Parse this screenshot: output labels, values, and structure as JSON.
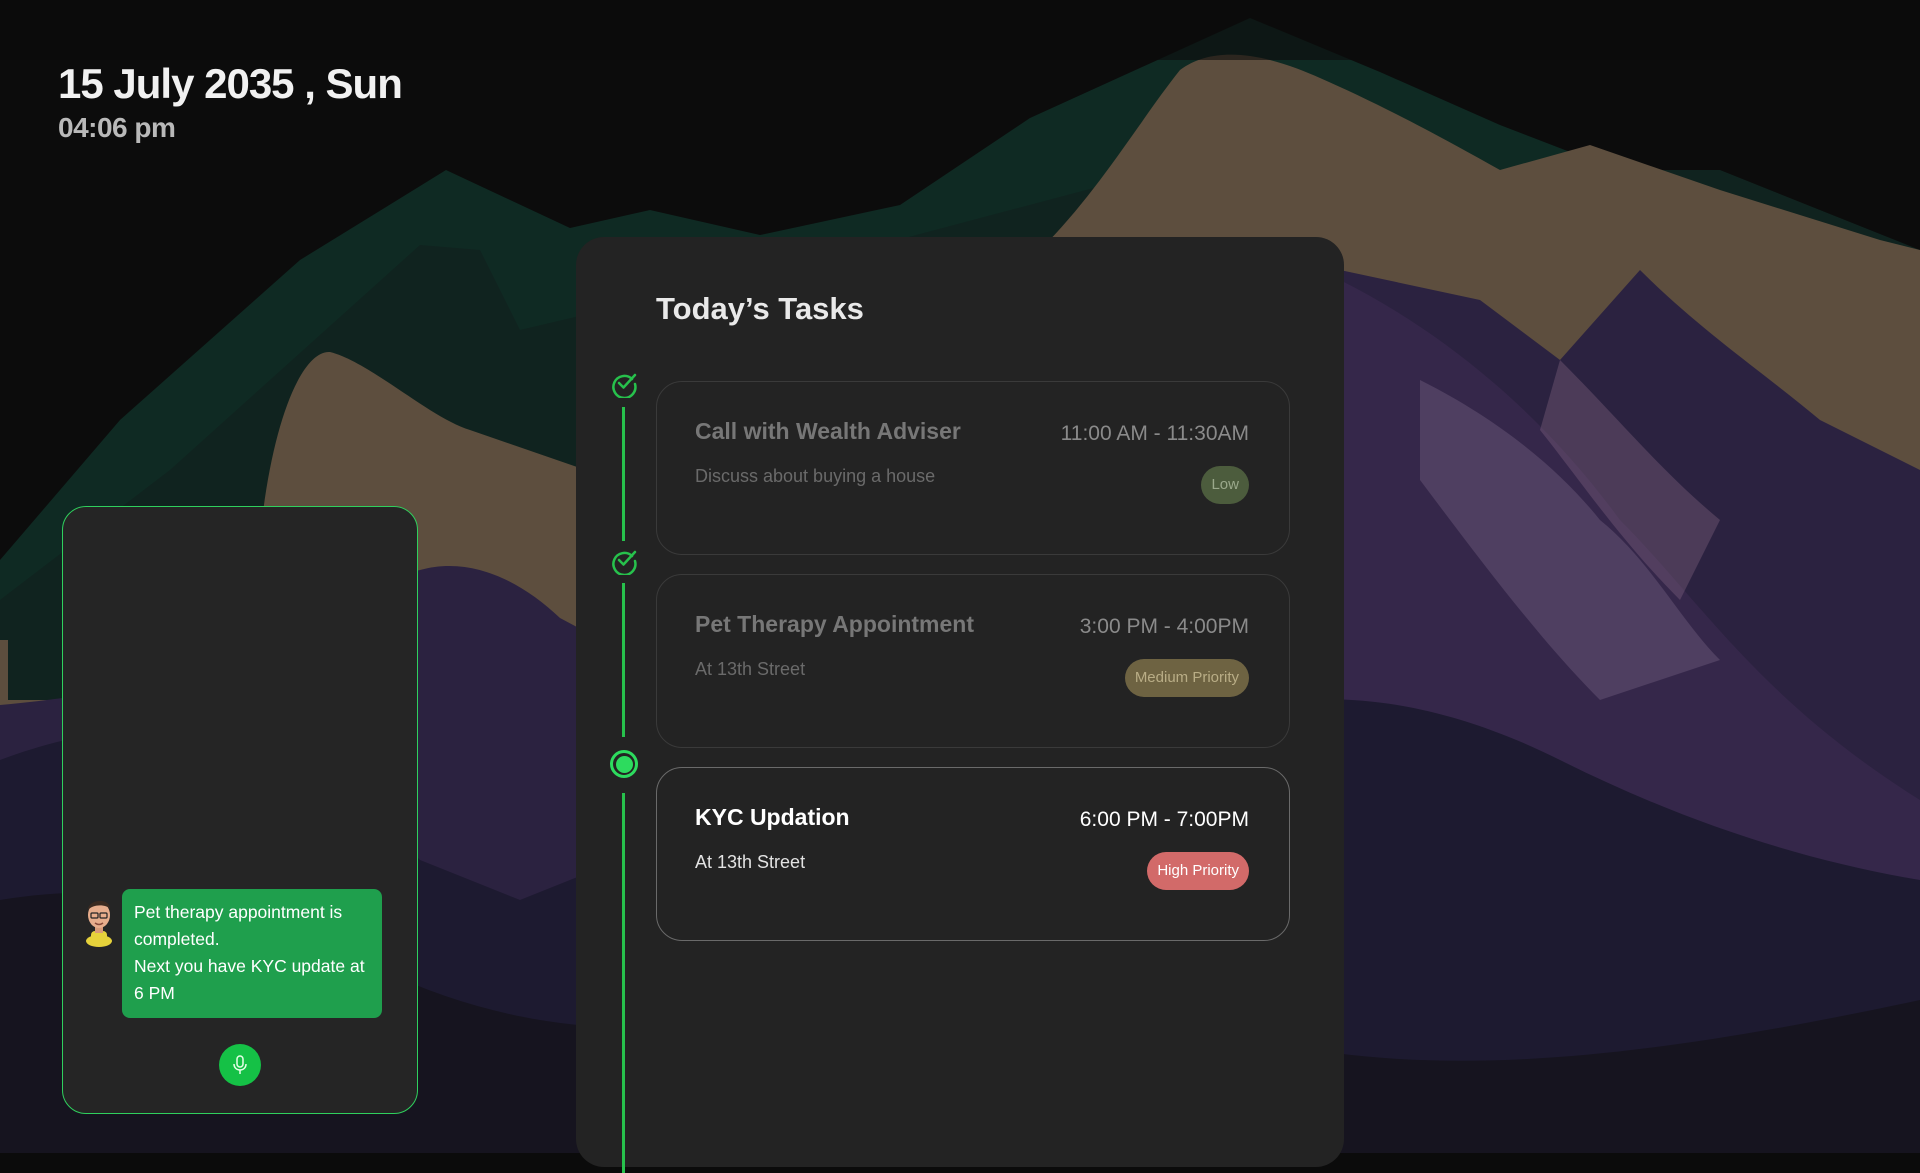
{
  "header": {
    "date": "15 July 2035 , Sun",
    "time": "04:06 pm"
  },
  "assistant": {
    "message_lines": [
      "Pet therapy appointment is",
      "completed.",
      "Next you have KYC update at",
      "6 PM"
    ],
    "mic_icon": "microphone-icon",
    "avatar_icon": "assistant-avatar-icon",
    "accent_color": "#2fd05d",
    "bubble_color": "#1f9f4d"
  },
  "tasks_panel": {
    "title": "Today’s Tasks",
    "items": [
      {
        "title": "Call with Wealth Adviser",
        "subtitle": "Discuss about buying a house",
        "time": "11:00 AM -  11:30AM",
        "priority": "Low",
        "status": "completed"
      },
      {
        "title": "Pet Therapy Appointment",
        "subtitle": "At 13th Street",
        "time": "3:00 PM - 4:00PM",
        "priority": "Medium Priority",
        "status": "completed"
      },
      {
        "title": "KYC Updation",
        "subtitle": "At 13th Street",
        "time": "6:00 PM - 7:00PM",
        "priority": "High Priority",
        "status": "current"
      }
    ],
    "timeline_color": "#27c14c"
  }
}
